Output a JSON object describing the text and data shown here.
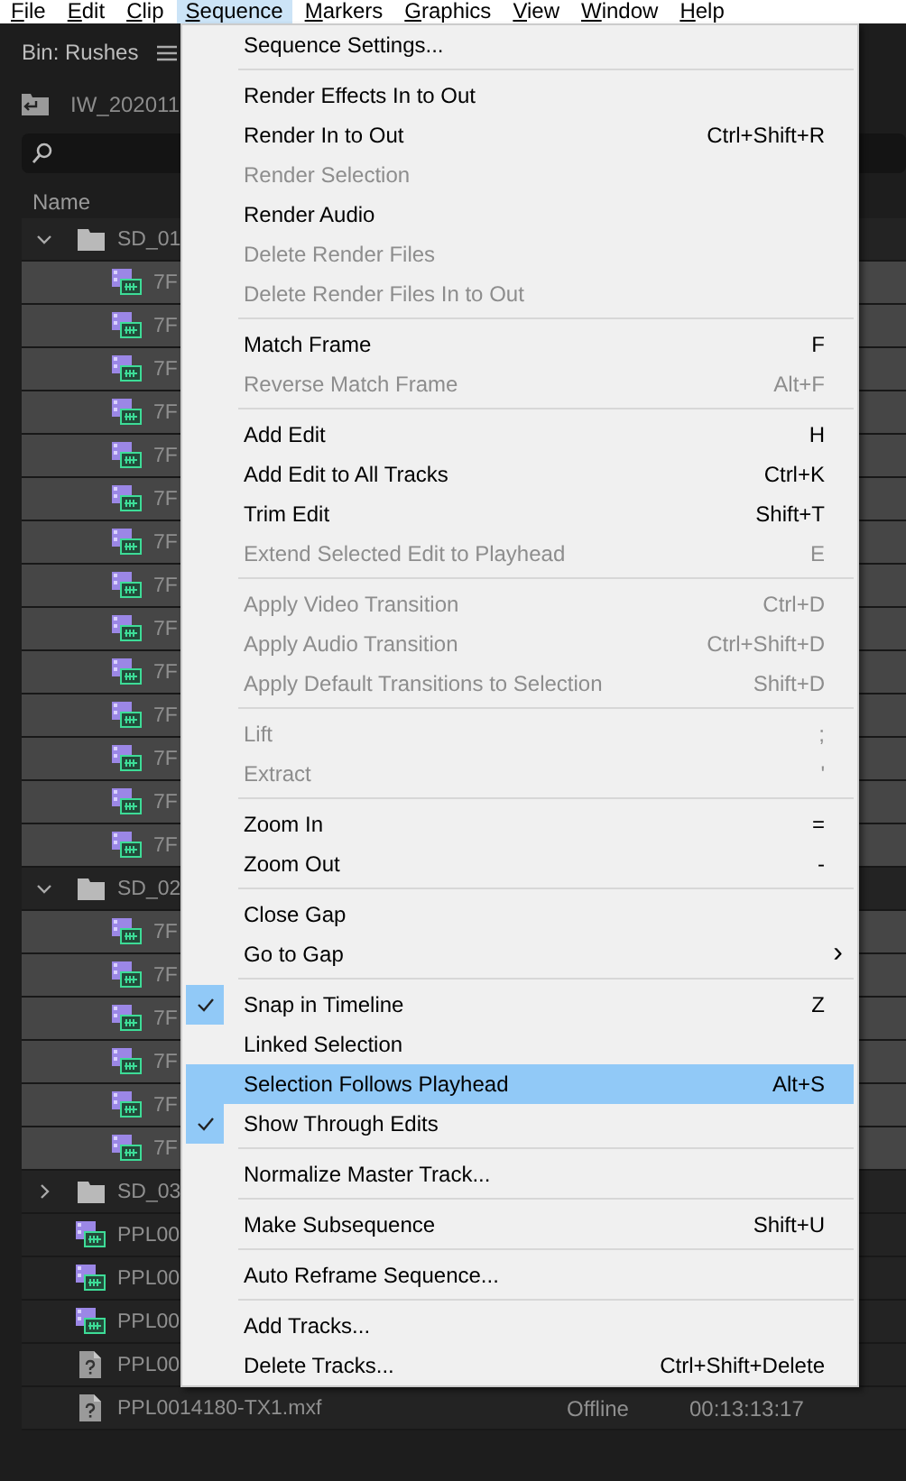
{
  "menu_bar": [
    {
      "label": "File",
      "selected": false
    },
    {
      "label": "Edit",
      "selected": false
    },
    {
      "label": "Clip",
      "selected": false
    },
    {
      "label": "Sequence",
      "selected": true
    },
    {
      "label": "Markers",
      "selected": false
    },
    {
      "label": "Graphics",
      "selected": false
    },
    {
      "label": "View",
      "selected": false
    },
    {
      "label": "Window",
      "selected": false
    },
    {
      "label": "Help",
      "selected": false
    }
  ],
  "bin_panel": {
    "title": "Bin: Rushes",
    "path": "IW_202011",
    "columns": [
      "Name"
    ],
    "rows": [
      {
        "kind": "folder",
        "name": "SD_01",
        "expanded": true,
        "selected": false,
        "children": [
          {
            "kind": "clip",
            "name": "7F",
            "selected": true
          },
          {
            "kind": "clip",
            "name": "7F",
            "selected": true
          },
          {
            "kind": "clip",
            "name": "7F",
            "selected": true
          },
          {
            "kind": "clip",
            "name": "7F",
            "selected": true
          },
          {
            "kind": "clip",
            "name": "7F",
            "selected": true
          },
          {
            "kind": "clip",
            "name": "7F",
            "selected": true
          },
          {
            "kind": "clip",
            "name": "7F",
            "selected": true
          },
          {
            "kind": "clip",
            "name": "7F",
            "selected": true
          },
          {
            "kind": "clip",
            "name": "7F",
            "selected": true
          },
          {
            "kind": "clip",
            "name": "7F",
            "selected": true
          },
          {
            "kind": "clip",
            "name": "7F",
            "selected": true
          },
          {
            "kind": "clip",
            "name": "7F",
            "selected": true
          },
          {
            "kind": "clip",
            "name": "7F",
            "selected": true
          },
          {
            "kind": "clip",
            "name": "7F",
            "selected": true
          }
        ]
      },
      {
        "kind": "folder",
        "name": "SD_02",
        "expanded": true,
        "selected": false,
        "children": [
          {
            "kind": "clip",
            "name": "7F",
            "selected": true
          },
          {
            "kind": "clip",
            "name": "7F",
            "selected": true
          },
          {
            "kind": "clip",
            "name": "7F",
            "selected": true
          },
          {
            "kind": "clip",
            "name": "7F",
            "selected": true
          },
          {
            "kind": "clip",
            "name": "7F",
            "selected": true
          },
          {
            "kind": "clip",
            "name": "7F",
            "selected": true
          }
        ]
      },
      {
        "kind": "folder",
        "name": "SD_03",
        "expanded": false,
        "selected": false
      },
      {
        "kind": "clip",
        "name": "PPL00",
        "selected": false
      },
      {
        "kind": "clip",
        "name": "PPL00",
        "selected": false
      },
      {
        "kind": "clip",
        "name": "PPL00",
        "selected": false
      },
      {
        "kind": "offline",
        "name": "PPL00",
        "selected": false
      },
      {
        "kind": "offline",
        "name": "PPL0014180-TX1.mxf",
        "selected": false,
        "status": "Offline",
        "duration": "00:13:13:17"
      }
    ]
  },
  "sequence_menu": {
    "sections": [
      {
        "items": [
          {
            "label": "Sequence Settings...",
            "disabled": false,
            "checked": false,
            "selected": false
          }
        ]
      },
      {
        "items": [
          {
            "label": "Render Effects In to Out",
            "disabled": false,
            "checked": false,
            "selected": false
          },
          {
            "label": "Render In to Out",
            "shortcut": "Ctrl+Shift+R",
            "disabled": false,
            "checked": false,
            "selected": false
          },
          {
            "label": "Render Selection",
            "disabled": true,
            "checked": false,
            "selected": false
          },
          {
            "label": "Render Audio",
            "disabled": false,
            "checked": false,
            "selected": false
          },
          {
            "label": "Delete Render Files",
            "disabled": true,
            "checked": false,
            "selected": false
          },
          {
            "label": "Delete Render Files In to Out",
            "disabled": true,
            "checked": false,
            "selected": false
          }
        ]
      },
      {
        "items": [
          {
            "label": "Match Frame",
            "shortcut": "F",
            "disabled": false,
            "checked": false,
            "selected": false
          },
          {
            "label": "Reverse Match Frame",
            "shortcut": "Alt+F",
            "disabled": true,
            "checked": false,
            "selected": false
          }
        ]
      },
      {
        "items": [
          {
            "label": "Add Edit",
            "shortcut": "H",
            "disabled": false,
            "checked": false,
            "selected": false
          },
          {
            "label": "Add Edit to All Tracks",
            "shortcut": "Ctrl+K",
            "disabled": false,
            "checked": false,
            "selected": false
          },
          {
            "label": "Trim Edit",
            "shortcut": "Shift+T",
            "disabled": false,
            "checked": false,
            "selected": false
          },
          {
            "label": "Extend Selected Edit to Playhead",
            "shortcut": "E",
            "disabled": true,
            "checked": false,
            "selected": false
          }
        ]
      },
      {
        "items": [
          {
            "label": "Apply Video Transition",
            "shortcut": "Ctrl+D",
            "disabled": true,
            "checked": false,
            "selected": false
          },
          {
            "label": "Apply Audio Transition",
            "shortcut": "Ctrl+Shift+D",
            "disabled": true,
            "checked": false,
            "selected": false
          },
          {
            "label": "Apply Default Transitions to Selection",
            "shortcut": "Shift+D",
            "disabled": true,
            "checked": false,
            "selected": false
          }
        ]
      },
      {
        "items": [
          {
            "label": "Lift",
            "shortcut": ";",
            "disabled": true,
            "checked": false,
            "selected": false
          },
          {
            "label": "Extract",
            "shortcut": "'",
            "disabled": true,
            "checked": false,
            "selected": false
          }
        ]
      },
      {
        "items": [
          {
            "label": "Zoom In",
            "shortcut": "=",
            "disabled": false,
            "checked": false,
            "selected": false
          },
          {
            "label": "Zoom Out",
            "shortcut": "-",
            "disabled": false,
            "checked": false,
            "selected": false
          }
        ]
      },
      {
        "items": [
          {
            "label": "Close Gap",
            "disabled": false,
            "checked": false,
            "selected": false
          },
          {
            "label": "Go to Gap",
            "submenu_arrow": "›",
            "disabled": false,
            "checked": false,
            "selected": false
          }
        ]
      },
      {
        "items": [
          {
            "label": "Snap in Timeline",
            "shortcut": "Z",
            "disabled": false,
            "checked": true,
            "selected": false
          },
          {
            "label": "Linked Selection",
            "disabled": false,
            "checked": false,
            "selected": false
          },
          {
            "label": "Selection Follows Playhead",
            "shortcut": "Alt+S",
            "disabled": false,
            "checked": false,
            "selected": true
          },
          {
            "label": "Show Through Edits",
            "disabled": false,
            "checked": true,
            "selected": false
          }
        ]
      },
      {
        "items": [
          {
            "label": "Normalize Master Track...",
            "disabled": false,
            "checked": false,
            "selected": false
          }
        ]
      },
      {
        "items": [
          {
            "label": "Make Subsequence",
            "shortcut": "Shift+U",
            "disabled": false,
            "checked": false,
            "selected": false
          }
        ]
      },
      {
        "items": [
          {
            "label": "Auto Reframe Sequence...",
            "disabled": false,
            "checked": false,
            "selected": false
          }
        ]
      },
      {
        "items": [
          {
            "label": "Add Tracks...",
            "disabled": false,
            "checked": false,
            "selected": false
          },
          {
            "label": "Delete Tracks...",
            "shortcut": "Ctrl+Shift+Delete",
            "disabled": false,
            "checked": false,
            "selected": false
          }
        ]
      }
    ]
  }
}
